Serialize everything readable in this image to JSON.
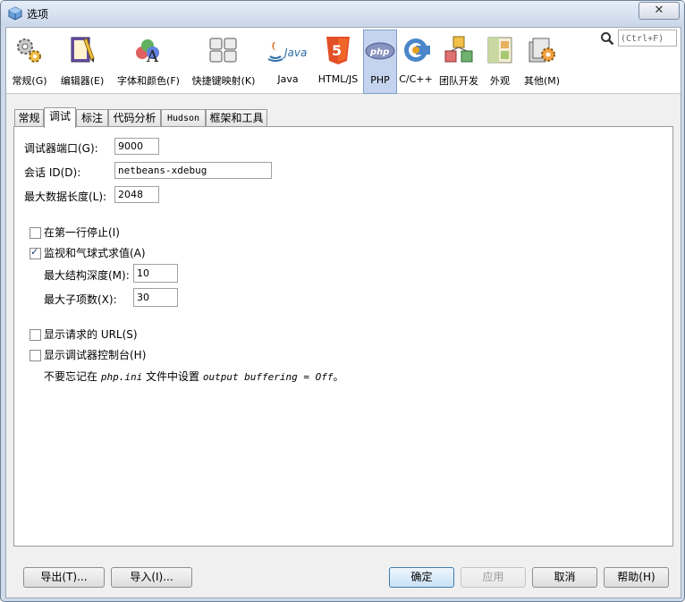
{
  "window": {
    "title": "选项",
    "close_label": "✕"
  },
  "search": {
    "hint": "(Ctrl+F)"
  },
  "categories": [
    {
      "label": "常规(G)",
      "icon": "gears-icon"
    },
    {
      "label": "编辑器(E)",
      "icon": "editor-icon"
    },
    {
      "label": "字体和颜色(F)",
      "icon": "fonts-colors-icon"
    },
    {
      "label": "快捷键映射(K)",
      "icon": "keymap-icon"
    },
    {
      "label": "Java",
      "icon": "java-icon"
    },
    {
      "label": "HTML/JS",
      "icon": "html5-icon"
    },
    {
      "label": "PHP",
      "icon": "php-icon",
      "selected": true
    },
    {
      "label": "C/C++",
      "icon": "cpp-icon"
    },
    {
      "label": "团队开发",
      "icon": "team-icon"
    },
    {
      "label": "外观",
      "icon": "appearance-icon"
    },
    {
      "label": "其他(M)",
      "icon": "misc-icon"
    }
  ],
  "tabs": [
    "常规",
    "调试",
    "标注",
    "代码分析",
    "Hudson",
    "框架和工具"
  ],
  "active_tab": "调试",
  "form": {
    "debugger_port": {
      "label": "调试器端口(G):",
      "value": "9000"
    },
    "session_id": {
      "label": "会话 ID(D):",
      "value": "netbeans-xdebug"
    },
    "max_data_length": {
      "label": "最大数据长度(L):",
      "value": "2048"
    },
    "stop_first_line": {
      "label": "在第一行停止(I)",
      "checked": false
    },
    "watches_balloon": {
      "label": "监视和气球式求值(A)",
      "checked": true
    },
    "max_struct_depth": {
      "label": "最大结构深度(M):",
      "value": "10"
    },
    "max_children": {
      "label": "最大子项数(X):",
      "value": "30"
    },
    "show_url": {
      "label": "显示请求的 URL(S)",
      "checked": false
    },
    "show_console": {
      "label": "显示调试器控制台(H)",
      "checked": false
    },
    "note_prefix": "不要忘记在 ",
    "note_file": "php.ini",
    "note_mid": " 文件中设置 ",
    "note_setting": "output buffering = Off",
    "note_suffix": "。"
  },
  "buttons": {
    "export": "导出(T)...",
    "import": "导入(I)...",
    "ok": "确定",
    "apply": "应用",
    "cancel": "取消",
    "help": "帮助(H)"
  }
}
